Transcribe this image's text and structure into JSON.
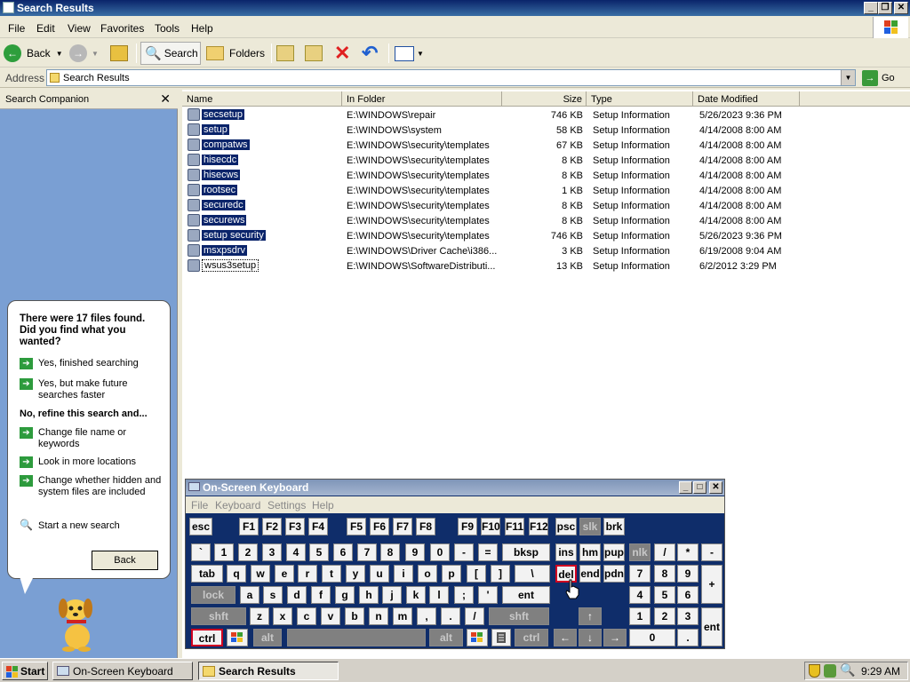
{
  "window": {
    "title": "Search Results"
  },
  "menu": [
    "File",
    "Edit",
    "View",
    "Favorites",
    "Tools",
    "Help"
  ],
  "toolbar": {
    "back": "Back",
    "search": "Search",
    "folders": "Folders"
  },
  "address": {
    "label": "Address",
    "value": "Search Results",
    "go": "Go"
  },
  "companion": {
    "title": "Search Companion",
    "question": "There were 17 files found. Did you find what you wanted?",
    "options": [
      "Yes, finished searching",
      "Yes, but make future searches faster"
    ],
    "refine_heading": "No, refine this search and...",
    "refine_options": [
      "Change file name or keywords",
      "Look in more locations",
      "Change whether hidden and system files are included"
    ],
    "new_search": "Start a new search",
    "back_button": "Back"
  },
  "columns": [
    "Name",
    "In Folder",
    "Size",
    "Type",
    "Date Modified"
  ],
  "files": [
    {
      "name": "secsetup",
      "folder": "E:\\WINDOWS\\repair",
      "size": "746 KB",
      "type": "Setup Information",
      "date": "5/26/2023 9:36 PM"
    },
    {
      "name": "setup",
      "folder": "E:\\WINDOWS\\system",
      "size": "58 KB",
      "type": "Setup Information",
      "date": "4/14/2008 8:00 AM"
    },
    {
      "name": "compatws",
      "folder": "E:\\WINDOWS\\security\\templates",
      "size": "67 KB",
      "type": "Setup Information",
      "date": "4/14/2008 8:00 AM"
    },
    {
      "name": "hisecdc",
      "folder": "E:\\WINDOWS\\security\\templates",
      "size": "8 KB",
      "type": "Setup Information",
      "date": "4/14/2008 8:00 AM"
    },
    {
      "name": "hisecws",
      "folder": "E:\\WINDOWS\\security\\templates",
      "size": "8 KB",
      "type": "Setup Information",
      "date": "4/14/2008 8:00 AM"
    },
    {
      "name": "rootsec",
      "folder": "E:\\WINDOWS\\security\\templates",
      "size": "1 KB",
      "type": "Setup Information",
      "date": "4/14/2008 8:00 AM"
    },
    {
      "name": "securedc",
      "folder": "E:\\WINDOWS\\security\\templates",
      "size": "8 KB",
      "type": "Setup Information",
      "date": "4/14/2008 8:00 AM"
    },
    {
      "name": "securews",
      "folder": "E:\\WINDOWS\\security\\templates",
      "size": "8 KB",
      "type": "Setup Information",
      "date": "4/14/2008 8:00 AM"
    },
    {
      "name": "setup security",
      "folder": "E:\\WINDOWS\\security\\templates",
      "size": "746 KB",
      "type": "Setup Information",
      "date": "5/26/2023 9:36 PM"
    },
    {
      "name": "msxpsdrv",
      "folder": "E:\\WINDOWS\\Driver Cache\\i386...",
      "size": "3 KB",
      "type": "Setup Information",
      "date": "6/19/2008 9:04 AM"
    },
    {
      "name": "wsus3setup",
      "folder": "E:\\WINDOWS\\SoftwareDistributi...",
      "size": "13 KB",
      "type": "Setup Information",
      "date": "6/2/2012 3:29 PM"
    }
  ],
  "osk": {
    "title": "On-Screen Keyboard",
    "menu": [
      "File",
      "Keyboard",
      "Settings",
      "Help"
    ],
    "keys": [
      "esc",
      "F1",
      "F2",
      "F3",
      "F4",
      "F5",
      "F6",
      "F7",
      "F8",
      "F9",
      "F10",
      "F11",
      "F12",
      "psc",
      "slk",
      "brk",
      "`",
      "1",
      "2",
      "3",
      "4",
      "5",
      "6",
      "7",
      "8",
      "9",
      "0",
      "-",
      "=",
      "bksp",
      "ins",
      "hm",
      "pup",
      "nlk",
      "/",
      "*",
      "-",
      "tab",
      "q",
      "w",
      "e",
      "r",
      "t",
      "y",
      "u",
      "i",
      "o",
      "p",
      "[",
      "]",
      "\\",
      "del",
      "end",
      "pdn",
      "7",
      "8",
      "9",
      "+",
      "lock",
      "a",
      "s",
      "d",
      "f",
      "g",
      "h",
      "j",
      "k",
      "l",
      ";",
      "'",
      "ent",
      "4",
      "5",
      "6",
      "shft",
      "z",
      "x",
      "c",
      "v",
      "b",
      "n",
      "m",
      ",",
      ".",
      "/",
      "shft",
      "1",
      "2",
      "3",
      "ent",
      "ctrl",
      "alt",
      "alt",
      "ctrl",
      "0",
      "."
    ]
  },
  "taskbar": {
    "start": "Start",
    "tasks": [
      "On-Screen Keyboard",
      "Search Results"
    ],
    "clock": "9:29 AM"
  }
}
